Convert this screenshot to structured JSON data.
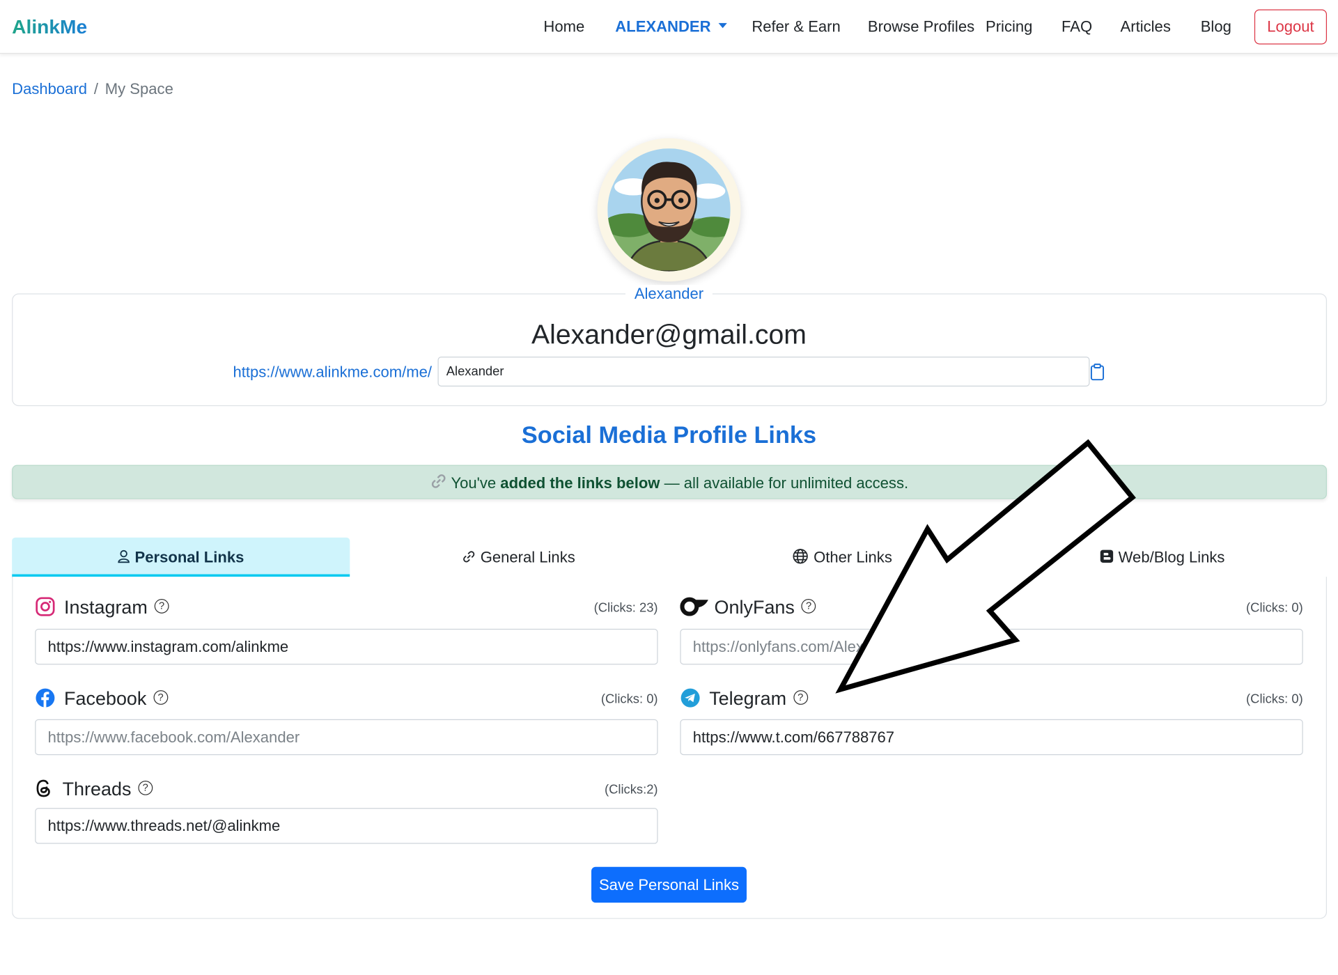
{
  "brand": "AlinkMe",
  "nav": {
    "home": "Home",
    "user": "ALEXANDER",
    "refer": "Refer & Earn",
    "browse": "Browse Profiles",
    "pricing": "Pricing",
    "faq": "FAQ",
    "articles": "Articles",
    "blog": "Blog",
    "logout": "Logout"
  },
  "breadcrumb": {
    "parent": "Dashboard",
    "separator": "/",
    "current": "My Space"
  },
  "profile": {
    "username": "Alexander",
    "email": "Alexander@gmail.com",
    "url_prefix": "https://www.alinkme.com/me/",
    "url_slug": "Alexander"
  },
  "section_title": "Social Media Profile Links",
  "alert": {
    "part1": "You've ",
    "bold": "added the links below",
    "part2": " — all available for unlimited access."
  },
  "tabs": [
    {
      "label": "Personal Links",
      "icon": "person-icon",
      "active": true
    },
    {
      "label": "General Links",
      "icon": "link-icon",
      "active": false
    },
    {
      "label": "Other Links",
      "icon": "globe-icon",
      "active": false
    },
    {
      "label": "Web/Blog Links",
      "icon": "blogger-icon",
      "active": false
    }
  ],
  "links": {
    "instagram": {
      "label": "Instagram",
      "clicks": "(Clicks: 23)",
      "value": "https://www.instagram.com/alinkme",
      "placeholder": ""
    },
    "onlyfans": {
      "label": "OnlyFans",
      "clicks": "(Clicks: 0)",
      "value": "",
      "placeholder": "https://onlyfans.com/Alexander"
    },
    "facebook": {
      "label": "Facebook",
      "clicks": "(Clicks: 0)",
      "value": "",
      "placeholder": "https://www.facebook.com/Alexander"
    },
    "telegram": {
      "label": "Telegram",
      "clicks": "(Clicks: 0)",
      "value": "https://www.t.com/667788767",
      "placeholder": ""
    },
    "threads": {
      "label": "Threads",
      "clicks": "(Clicks:2)",
      "value": "https://www.threads.net/@alinkme",
      "placeholder": ""
    }
  },
  "help_glyph": "?",
  "save_button": "Save Personal Links",
  "colors": {
    "primary": "#0d6efd",
    "link": "#1a6fd6",
    "logout": "#dc3545",
    "alert_bg": "#d1e7dd",
    "tab_active_bg": "#cff4fc",
    "tab_active_border": "#0dcaf0"
  }
}
